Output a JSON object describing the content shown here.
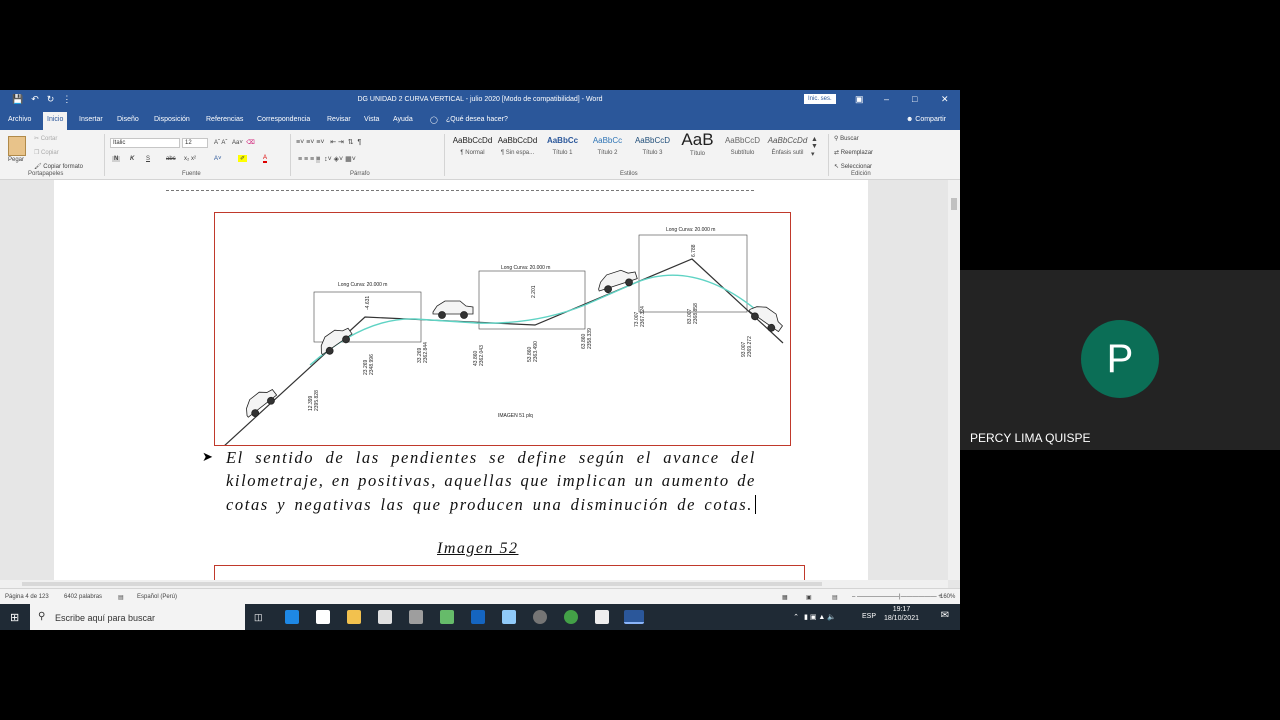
{
  "window": {
    "title": "DG UNIDAD 2 CURVA VERTICAL - julio 2020 [Modo de compatibilidad] - Word",
    "sign_in": "Inic. ses."
  },
  "tabs": [
    "Archivo",
    "Inicio",
    "Insertar",
    "Diseño",
    "Disposición",
    "Referencias",
    "Correspondencia",
    "Revisar",
    "Vista",
    "Ayuda"
  ],
  "tell_me": "¿Qué desea hacer?",
  "share": "Compartir",
  "ribbon": {
    "clipboard": {
      "paste": "Pegar",
      "cut": "Cortar",
      "copy": "Copiar",
      "format_painter": "Copiar formato",
      "label": "Portapapeles"
    },
    "font": {
      "name": "Italic",
      "size": "12",
      "label": "Fuente",
      "bold": "N",
      "italic": "K",
      "underline": "S",
      "strike": "abc"
    },
    "paragraph": {
      "label": "Párrafo"
    },
    "styles": {
      "label": "Estilos",
      "items": [
        {
          "sample": "AaBbCcDd",
          "name": "¶ Normal"
        },
        {
          "sample": "AaBbCcDd",
          "name": "¶ Sin espa..."
        },
        {
          "sample": "AaBbCc",
          "name": "Título 1"
        },
        {
          "sample": "AaBbCc",
          "name": "Título 2"
        },
        {
          "sample": "AaBbCcD",
          "name": "Título 3"
        },
        {
          "sample": "AaB",
          "name": "Título"
        },
        {
          "sample": "AaBbCcD",
          "name": "Subtítulo"
        },
        {
          "sample": "AaBbCcDd",
          "name": "Énfasis sutil"
        }
      ]
    },
    "editing": {
      "find": "Buscar",
      "replace": "Reemplazar",
      "select": "Seleccionar",
      "label": "Edición"
    }
  },
  "figure": {
    "curve_labels": [
      "Long Curva: 20.000 m",
      "Long Curva: 20.000 m",
      "Long Curva: 20.000 m"
    ],
    "offsets": [
      "-4.631",
      "2.201",
      "6.788"
    ],
    "station_labels": [
      {
        "a": "12.399",
        "b": "2395.828"
      },
      {
        "a": "23.269",
        "b": "2348.996"
      },
      {
        "a": "33.269",
        "b": "2362.844"
      },
      {
        "a": "43.860",
        "b": "2362.043"
      },
      {
        "a": "53.860",
        "b": "2363.490"
      },
      {
        "a": "63.860",
        "b": "2358.339"
      },
      {
        "a": "73.007",
        "b": "2367.324"
      },
      {
        "a": "83.007",
        "b": "2368.858"
      },
      {
        "a": "93.007",
        "b": "2369.272"
      }
    ],
    "caption": "IMAGEN 51 plq"
  },
  "document": {
    "paragraph_lines": [
      "El sentido de las pendientes se define según el",
      "avance del kilometraje, en positivas, aquellas que",
      "implican un aumento de cotas y negativas las",
      "que producen una disminución de cotas."
    ],
    "next_caption": "Imagen 52"
  },
  "status": {
    "page": "Página 4 de 123",
    "words": "6402 palabras",
    "language": "Español (Perú)",
    "zoom": "160%"
  },
  "taskbar": {
    "search_placeholder": "Escribe aquí para buscar",
    "lang": "ESP",
    "time": "19:17",
    "date": "18/10/2021"
  },
  "participant": {
    "initial": "P",
    "name": "PERCY LIMA QUISPE"
  },
  "colors": {
    "word_blue": "#2b579a",
    "avatar_green": "#0b6e56",
    "figure_border": "#c0392b"
  }
}
